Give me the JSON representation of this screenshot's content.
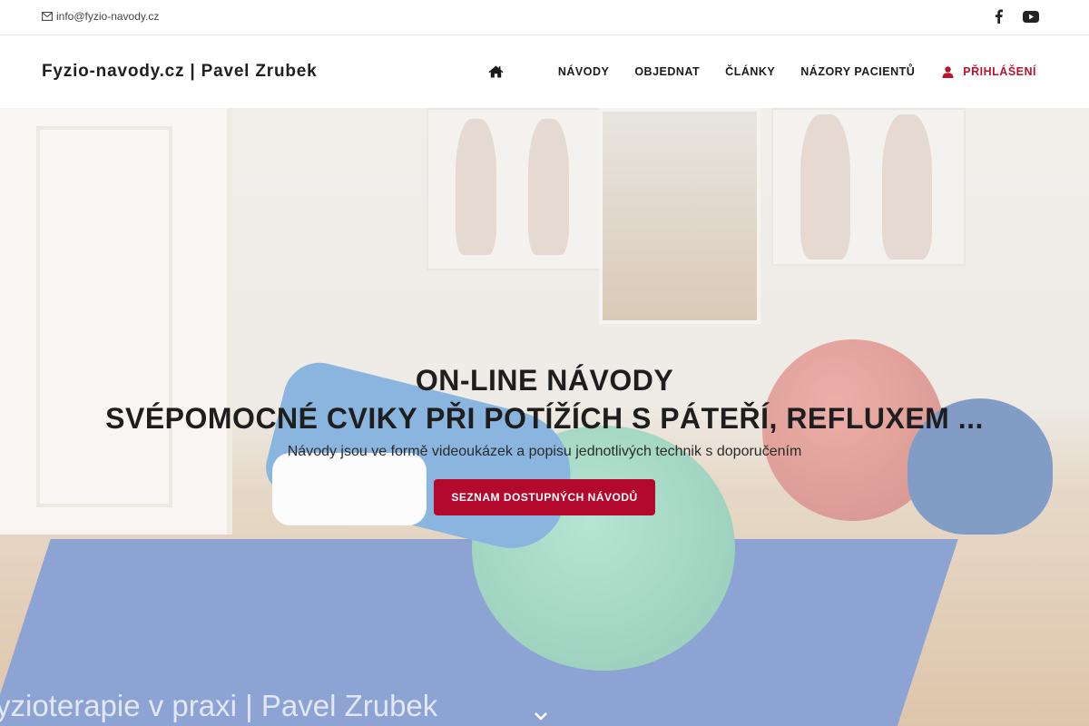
{
  "topbar": {
    "email": "info@fyzio-navody.cz",
    "icons": [
      "mail-icon",
      "facebook-icon",
      "youtube-icon"
    ]
  },
  "header": {
    "brand": "Fyzio-navody.cz | Pavel Zrubek",
    "nav": {
      "home_icon": "home-icon",
      "items": [
        "NÁVODY",
        "OBJEDNAT",
        "ČLÁNKY",
        "NÁZORY PACIENTŮ"
      ],
      "login_label": "PŘIHLÁŠENÍ",
      "login_icon": "user-icon"
    }
  },
  "hero": {
    "title_line1": "ON-LINE NÁVODY",
    "title_line2": "SVÉPOMOCNÉ CVIKY PŘI POTÍŽÍCH S PÁTEŘÍ, REFLUXEM ...",
    "subtitle": "Návody jsou ve formě videoukázek a popisu jednotlivých technik s doporučením",
    "cta_label": "SEZNAM DOSTUPNÝCH NÁVODŮ",
    "watermark": "yzioterapie v praxi | Pavel Zrubek",
    "scroll_icon": "chevron-down-icon"
  },
  "colors": {
    "accent": "#b3092d",
    "login": "#b8142f",
    "text": "#1e1e1e"
  }
}
